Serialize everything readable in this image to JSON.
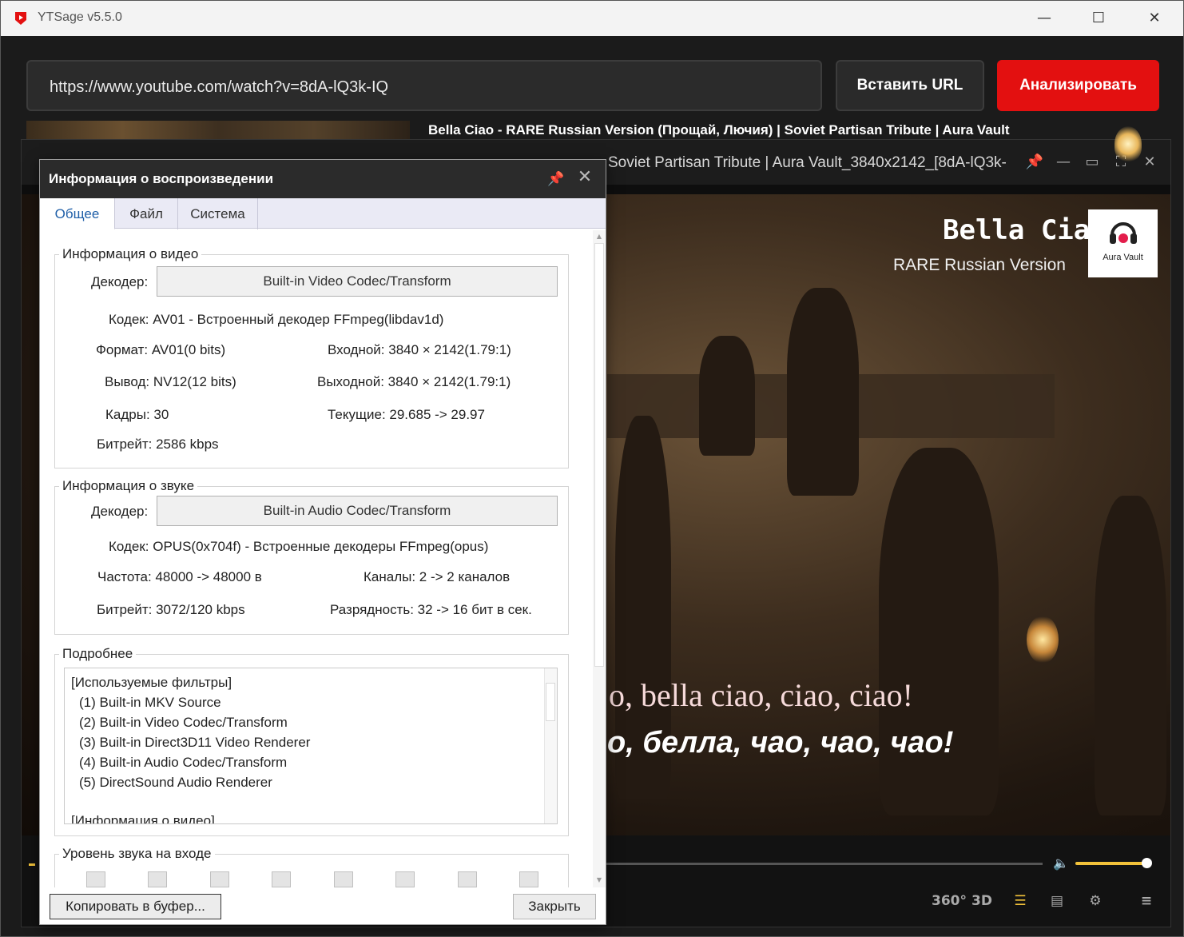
{
  "app": {
    "title": "YTSage  v5.5.0"
  },
  "url_bar": {
    "value": "https://www.youtube.com/watch?v=8dA-lQ3k-IQ"
  },
  "buttons": {
    "paste": "Вставить URL",
    "analyze": "Анализировать"
  },
  "video": {
    "title": "Bella Ciao - RARE Russian Version (Прощай, Лючия) | Soviet Partisan Tribute | Aura Vault"
  },
  "player": {
    "title": "Soviet Partisan Tribute  |  Aura Vault_3840x2142_[8dA-lQ3k-",
    "overlay_title": "Bella Ciao",
    "overlay_subtitle": "RARE Russian Version",
    "brand": "Aura Vault",
    "subtitle_line1": "o, bella ciao, ciao, ciao!",
    "subtitle_line2": "o, белла, чао, чао, чао!",
    "volume_level": 0.93,
    "buttons": {
      "vr": "360°",
      "three_d": "3D"
    }
  },
  "dialog": {
    "title": "Информация о воспроизведении",
    "tabs": [
      "Общее",
      "Файл",
      "Система"
    ],
    "video_info": {
      "label": "Информация о видео",
      "decoder_label": "Декодер:",
      "decoder_value": "Built-in Video Codec/Transform",
      "codec": "Кодек: AV01 - Встроенный декодер FFmpeg(libdav1d)",
      "format": "Формат: AV01(0 bits)",
      "input": "Входной: 3840 × 2142(1.79:1)",
      "output": "Вывод: NV12(12 bits)",
      "output_res": "Выходной: 3840 × 2142(1.79:1)",
      "frames": "Кадры: 30",
      "current": "Текущие: 29.685 -> 29.97",
      "bitrate": "Битрейт: 2586 kbps"
    },
    "audio_info": {
      "label": "Информация о звуке",
      "decoder_label": "Декодер:",
      "decoder_value": "Built-in Audio Codec/Transform",
      "codec": "Кодек: OPUS(0x704f) - Встроенные декодеры FFmpeg(opus)",
      "frequency": "Частота: 48000 -> 48000 в",
      "channels": "Каналы: 2 -> 2 каналов",
      "bitrate": "Битрейт: 3072/120 kbps",
      "bit_depth": "Разрядность: 32 -> 16 бит в сек."
    },
    "details": {
      "label": "Подробнее",
      "lines": [
        "[Используемые фильтры]",
        "  (1) Built-in MKV Source",
        "  (2) Built-in Video Codec/Transform",
        "  (3) Built-in Direct3D11 Video Renderer",
        "  (4) Built-in Audio Codec/Transform",
        "  (5) DirectSound Audio Renderer",
        "",
        "[Информация о видео]"
      ]
    },
    "audio_level": {
      "label": "Уровень звука на входе"
    },
    "footer": {
      "copy": "Копировать в буфер...",
      "close": "Закрыть"
    }
  },
  "colors": {
    "accent_red": "#e31010",
    "accent_yellow": "#f2c23a",
    "tab_active": "#1f5fa8"
  }
}
